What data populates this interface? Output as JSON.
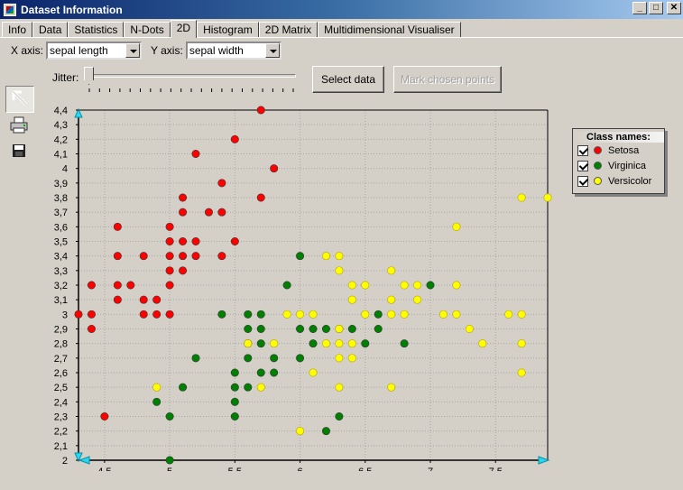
{
  "window": {
    "title": "Dataset Information",
    "icon": "app-icon"
  },
  "tabs": [
    {
      "label": "Info",
      "active": false
    },
    {
      "label": "Data",
      "active": false
    },
    {
      "label": "Statistics",
      "active": false
    },
    {
      "label": "N-Dots",
      "active": false
    },
    {
      "label": "2D",
      "active": true
    },
    {
      "label": "Histogram",
      "active": false
    },
    {
      "label": "2D Matrix",
      "active": false
    },
    {
      "label": "Multidimensional Visualiser",
      "active": false
    }
  ],
  "controls": {
    "x_axis_label": "X axis:",
    "x_axis_value": "sepal length",
    "y_axis_label": "Y axis:",
    "y_axis_value": "sepal width",
    "jitter_label": "Jitter:",
    "jitter_value": 0,
    "select_button": "Select data",
    "mark_button": "Mark chosen points"
  },
  "toolbar": [
    "pointer-arrow-icon",
    "print-icon",
    "save-icon"
  ],
  "legend": {
    "title": "Class names:",
    "items": [
      {
        "name": "Setosa",
        "color": "#ff0000",
        "checked": true
      },
      {
        "name": "Virginica",
        "color": "#008000",
        "checked": true
      },
      {
        "name": "Versicolor",
        "color": "#ffff00",
        "checked": true
      }
    ]
  },
  "chart_data": {
    "type": "scatter",
    "xlim": [
      4.3,
      7.9
    ],
    "ylim": [
      2.0,
      4.4
    ],
    "x_ticks": [
      "4,5",
      "5",
      "5,5",
      "6",
      "6,5",
      "7",
      "7,5"
    ],
    "x_tick_values": [
      4.5,
      5,
      5.5,
      6,
      6.5,
      7,
      7.5
    ],
    "y_ticks": [
      "2",
      "2,1",
      "2,2",
      "2,3",
      "2,4",
      "2,5",
      "2,6",
      "2,7",
      "2,8",
      "2,9",
      "3",
      "3,1",
      "3,2",
      "3,3",
      "3,4",
      "3,5",
      "3,6",
      "3,7",
      "3,8",
      "3,9",
      "4",
      "4,1",
      "4,2",
      "4,3",
      "4,4"
    ],
    "y_tick_values": [
      2.0,
      2.1,
      2.2,
      2.3,
      2.4,
      2.5,
      2.6,
      2.7,
      2.8,
      2.9,
      3.0,
      3.1,
      3.2,
      3.3,
      3.4,
      3.5,
      3.6,
      3.7,
      3.8,
      3.9,
      4.0,
      4.1,
      4.2,
      4.3,
      4.4
    ],
    "grid": true,
    "legend_position": "right",
    "series": [
      {
        "name": "Setosa",
        "color": "#ff0000",
        "points": [
          [
            4.3,
            3.0
          ],
          [
            4.4,
            3.2
          ],
          [
            4.4,
            3.0
          ],
          [
            4.4,
            2.9
          ],
          [
            4.5,
            2.3
          ],
          [
            4.6,
            3.6
          ],
          [
            4.6,
            3.4
          ],
          [
            4.6,
            3.2
          ],
          [
            4.6,
            3.1
          ],
          [
            4.7,
            3.2
          ],
          [
            4.8,
            3.4
          ],
          [
            4.8,
            3.1
          ],
          [
            4.8,
            3.0
          ],
          [
            4.9,
            3.1
          ],
          [
            4.9,
            3.0
          ],
          [
            5.0,
            3.6
          ],
          [
            5.0,
            3.5
          ],
          [
            5.0,
            3.4
          ],
          [
            5.0,
            3.3
          ],
          [
            5.0,
            3.2
          ],
          [
            5.0,
            3.0
          ],
          [
            5.1,
            3.8
          ],
          [
            5.1,
            3.7
          ],
          [
            5.1,
            3.5
          ],
          [
            5.1,
            3.4
          ],
          [
            5.1,
            3.3
          ],
          [
            5.2,
            4.1
          ],
          [
            5.2,
            3.5
          ],
          [
            5.2,
            3.4
          ],
          [
            5.3,
            3.7
          ],
          [
            5.4,
            3.9
          ],
          [
            5.4,
            3.7
          ],
          [
            5.4,
            3.4
          ],
          [
            5.5,
            4.2
          ],
          [
            5.5,
            3.5
          ],
          [
            5.7,
            4.4
          ],
          [
            5.7,
            3.8
          ],
          [
            5.8,
            4.0
          ]
        ]
      },
      {
        "name": "Virginica",
        "color": "#008000",
        "points": [
          [
            4.9,
            2.4
          ],
          [
            5.0,
            2.3
          ],
          [
            5.0,
            2.0
          ],
          [
            5.1,
            2.5
          ],
          [
            5.2,
            2.7
          ],
          [
            5.4,
            3.0
          ],
          [
            5.5,
            2.6
          ],
          [
            5.5,
            2.5
          ],
          [
            5.5,
            2.4
          ],
          [
            5.5,
            2.3
          ],
          [
            5.6,
            3.0
          ],
          [
            5.6,
            2.9
          ],
          [
            5.6,
            2.8
          ],
          [
            5.6,
            2.7
          ],
          [
            5.6,
            2.5
          ],
          [
            5.7,
            3.0
          ],
          [
            5.7,
            2.9
          ],
          [
            5.7,
            2.8
          ],
          [
            5.7,
            2.6
          ],
          [
            5.8,
            2.7
          ],
          [
            5.8,
            2.6
          ],
          [
            5.9,
            3.2
          ],
          [
            6.0,
            3.4
          ],
          [
            6.0,
            2.9
          ],
          [
            6.0,
            2.7
          ],
          [
            6.1,
            2.9
          ],
          [
            6.1,
            2.8
          ],
          [
            6.2,
            2.9
          ],
          [
            6.2,
            2.2
          ],
          [
            6.3,
            2.9
          ],
          [
            6.3,
            2.3
          ],
          [
            6.4,
            2.9
          ],
          [
            6.5,
            2.8
          ],
          [
            6.6,
            3.0
          ],
          [
            6.6,
            2.9
          ],
          [
            6.8,
            2.8
          ],
          [
            7.0,
            3.2
          ]
        ]
      },
      {
        "name": "Versicolor",
        "color": "#ffff00",
        "points": [
          [
            4.9,
            2.5
          ],
          [
            5.6,
            2.8
          ],
          [
            5.7,
            2.5
          ],
          [
            5.8,
            2.8
          ],
          [
            5.9,
            3.0
          ],
          [
            6.0,
            3.0
          ],
          [
            6.0,
            2.2
          ],
          [
            6.1,
            3.0
          ],
          [
            6.1,
            2.6
          ],
          [
            6.2,
            3.4
          ],
          [
            6.2,
            2.8
          ],
          [
            6.3,
            3.4
          ],
          [
            6.3,
            3.3
          ],
          [
            6.3,
            2.9
          ],
          [
            6.3,
            2.8
          ],
          [
            6.3,
            2.7
          ],
          [
            6.3,
            2.5
          ],
          [
            6.4,
            3.2
          ],
          [
            6.4,
            3.1
          ],
          [
            6.4,
            2.8
          ],
          [
            6.4,
            2.7
          ],
          [
            6.5,
            3.2
          ],
          [
            6.5,
            3.0
          ],
          [
            6.7,
            3.3
          ],
          [
            6.7,
            3.1
          ],
          [
            6.7,
            3.0
          ],
          [
            6.7,
            2.5
          ],
          [
            6.8,
            3.2
          ],
          [
            6.8,
            3.0
          ],
          [
            6.9,
            3.2
          ],
          [
            6.9,
            3.1
          ],
          [
            7.1,
            3.0
          ],
          [
            7.2,
            3.6
          ],
          [
            7.2,
            3.2
          ],
          [
            7.2,
            3.0
          ],
          [
            7.3,
            2.9
          ],
          [
            7.4,
            2.8
          ],
          [
            7.6,
            3.0
          ],
          [
            7.7,
            3.8
          ],
          [
            7.7,
            3.0
          ],
          [
            7.7,
            2.8
          ],
          [
            7.7,
            2.6
          ],
          [
            7.9,
            3.8
          ]
        ]
      }
    ]
  }
}
